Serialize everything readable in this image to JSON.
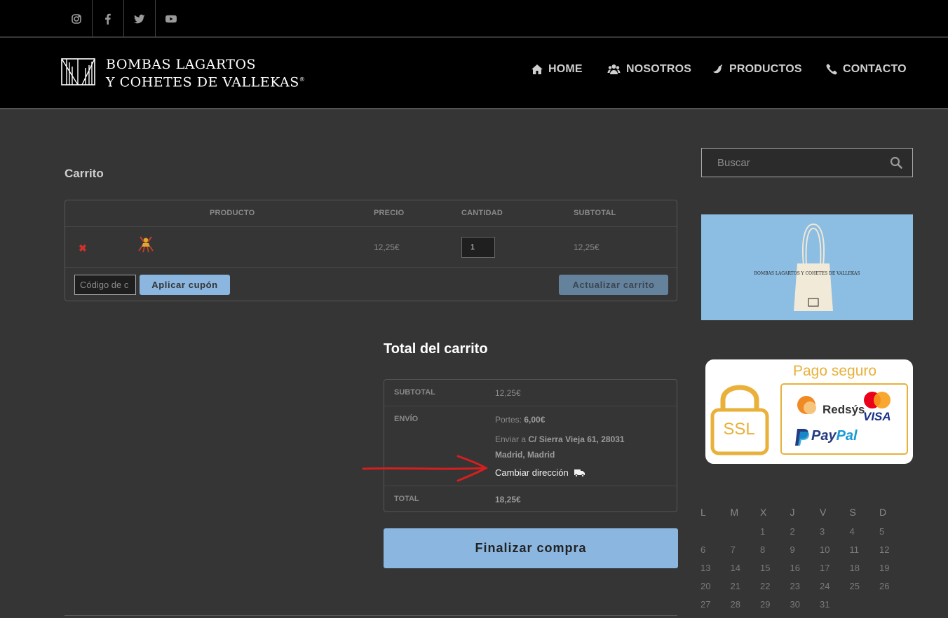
{
  "topbar": {
    "social": [
      {
        "name": "instagram-icon"
      },
      {
        "name": "facebook-icon"
      },
      {
        "name": "twitter-icon"
      },
      {
        "name": "youtube-icon"
      }
    ]
  },
  "header": {
    "logo_line1": "BOMBAS LAGARTOS",
    "logo_line2": "Y COHETES DE VALLEKAS",
    "logo_reg": "®",
    "nav": [
      {
        "label": "HOME",
        "icon": "home-icon"
      },
      {
        "label": "NOSOTROS",
        "icon": "users-icon"
      },
      {
        "label": "PRODUCTOS",
        "icon": "chili-icon"
      },
      {
        "label": "CONTACTO",
        "icon": "phone-icon"
      }
    ]
  },
  "cart": {
    "title": "Carrito",
    "headers": {
      "product": "PRODUCTO",
      "price": "PRECIO",
      "quantity": "CANTIDAD",
      "subtotal": "SUBTOTAL"
    },
    "items": [
      {
        "remove": "✖",
        "price": "12,25€",
        "quantity": "1",
        "subtotal": "12,25€"
      }
    ],
    "coupon_placeholder": "Código de c",
    "apply_coupon": "Aplicar cupón",
    "update_cart": "Actualizar carrito"
  },
  "totals": {
    "title": "Total del carrito",
    "subtotal_label": "SUBTOTAL",
    "subtotal_value": "12,25€",
    "shipping_label": "ENVÍO",
    "shipping_prefix": "Portes:",
    "shipping_value": "6,00€",
    "ship_to_prefix": "Enviar a",
    "ship_to_address": "C/ Sierra Vieja 61, 28031 Madrid, Madrid",
    "change_address": "Cambiar dirección",
    "total_label": "TOTAL",
    "total_value": "18,25€",
    "checkout": "Finalizar compra"
  },
  "sidebar": {
    "search_placeholder": "Buscar",
    "promo_bag_text": "BOMBAS LAGARTOS Y COHETES DE VALLEKAS",
    "secure_title": "Pago seguro",
    "ssl": "SSL",
    "redsys": "Redsýs",
    "visa": "VISA",
    "paypal_a": "Pay",
    "paypal_b": "Pal",
    "calendar": {
      "days": [
        "L",
        "M",
        "X",
        "J",
        "V",
        "S",
        "D"
      ],
      "weeks": [
        [
          "",
          "",
          "1",
          "2",
          "3",
          "4",
          "5"
        ],
        [
          "6",
          "7",
          "8",
          "9",
          "10",
          "11",
          "12"
        ],
        [
          "13",
          "14",
          "15",
          "16",
          "17",
          "18",
          "19"
        ],
        [
          "20",
          "21",
          "22",
          "23",
          "24",
          "25",
          "26"
        ],
        [
          "27",
          "28",
          "29",
          "30",
          "31",
          "",
          ""
        ]
      ]
    }
  },
  "colors": {
    "accent": "#8ab6e0",
    "background": "#353535",
    "remove": "#d0312d",
    "gold": "#e9b03a"
  }
}
